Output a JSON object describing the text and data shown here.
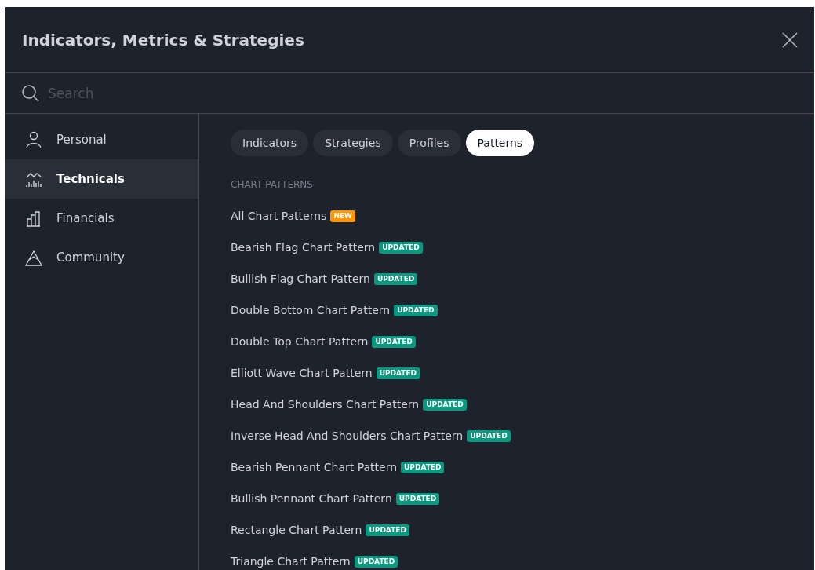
{
  "dialog": {
    "title": "Indicators, Metrics & Strategies"
  },
  "search": {
    "placeholder": "Search"
  },
  "sidebar": {
    "items": [
      {
        "label": "Personal",
        "kind": "person",
        "selected": false
      },
      {
        "label": "Technicals",
        "kind": "technicals",
        "selected": true
      },
      {
        "label": "Financials",
        "kind": "financials",
        "selected": false
      },
      {
        "label": "Community",
        "kind": "community",
        "selected": false
      }
    ]
  },
  "tabs": [
    {
      "label": "Indicators",
      "selected": false
    },
    {
      "label": "Strategies",
      "selected": false
    },
    {
      "label": "Profiles",
      "selected": false
    },
    {
      "label": "Patterns",
      "selected": true
    }
  ],
  "section": {
    "heading": "CHART PATTERNS",
    "items": [
      {
        "label": "All Chart Patterns",
        "badge": {
          "text": "NEW",
          "kind": "new"
        }
      },
      {
        "label": "Bearish Flag Chart Pattern",
        "badge": {
          "text": "UPDATED",
          "kind": "updated"
        }
      },
      {
        "label": "Bullish Flag Chart Pattern",
        "badge": {
          "text": "UPDATED",
          "kind": "updated"
        }
      },
      {
        "label": "Double Bottom Chart Pattern",
        "badge": {
          "text": "UPDATED",
          "kind": "updated"
        }
      },
      {
        "label": "Double Top Chart Pattern",
        "badge": {
          "text": "UPDATED",
          "kind": "updated"
        }
      },
      {
        "label": "Elliott Wave Chart Pattern",
        "badge": {
          "text": "UPDATED",
          "kind": "updated"
        }
      },
      {
        "label": "Head And Shoulders Chart Pattern",
        "badge": {
          "text": "UPDATED",
          "kind": "updated"
        }
      },
      {
        "label": "Inverse Head And Shoulders Chart Pattern",
        "badge": {
          "text": "UPDATED",
          "kind": "updated"
        }
      },
      {
        "label": "Bearish Pennant Chart Pattern",
        "badge": {
          "text": "UPDATED",
          "kind": "updated"
        }
      },
      {
        "label": "Bullish Pennant Chart Pattern",
        "badge": {
          "text": "UPDATED",
          "kind": "updated"
        }
      },
      {
        "label": "Rectangle Chart Pattern",
        "badge": {
          "text": "UPDATED",
          "kind": "updated"
        }
      },
      {
        "label": "Triangle Chart Pattern",
        "badge": {
          "text": "UPDATED",
          "kind": "updated"
        }
      }
    ]
  }
}
